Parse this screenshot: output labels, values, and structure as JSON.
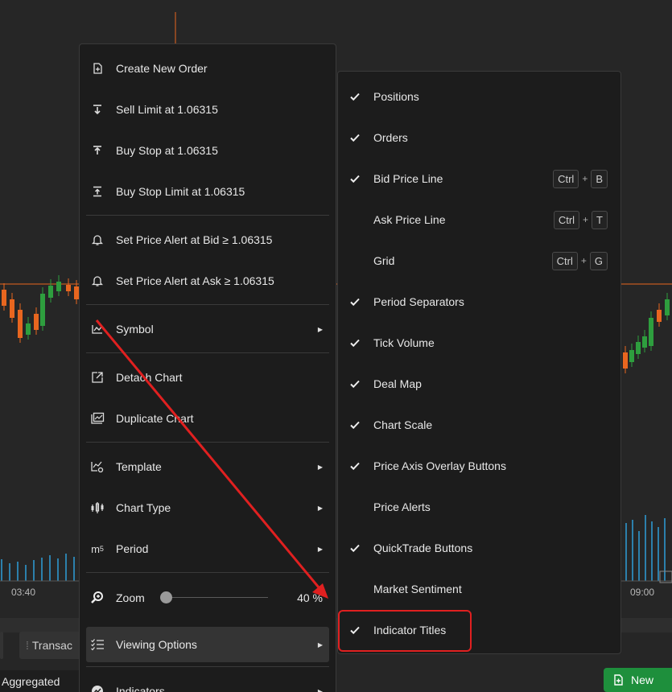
{
  "chart": {
    "time_labels": [
      "03:40",
      "09:00"
    ],
    "colors": {
      "up": "#2e9e3e",
      "down": "#e8661f",
      "volume": "#2f9fd8",
      "price_line": "#e8661f"
    }
  },
  "bottom": {
    "tab_partial": "Transac",
    "aggregated": "Aggregated",
    "new_order": "New"
  },
  "main_menu": {
    "create_order": "Create New Order",
    "sell_limit": "Sell Limit at 1.06315",
    "buy_stop": "Buy Stop at 1.06315",
    "buy_stop_limit": "Buy Stop Limit at 1.06315",
    "alert_bid": "Set Price Alert at Bid ≥ 1.06315",
    "alert_ask": "Set Price Alert at Ask ≥ 1.06315",
    "symbol": "Symbol",
    "detach": "Detach Chart",
    "duplicate": "Duplicate Chart",
    "template": "Template",
    "chart_type": "Chart Type",
    "period": "Period",
    "zoom": "Zoom",
    "zoom_value": "40 %",
    "viewing_options": "Viewing Options",
    "indicators": "Indicators"
  },
  "viewing_options": [
    {
      "label": "Positions",
      "checked": true
    },
    {
      "label": "Orders",
      "checked": true
    },
    {
      "label": "Bid Price Line",
      "checked": true,
      "shortcut": [
        "Ctrl",
        "+",
        "B"
      ]
    },
    {
      "label": "Ask Price Line",
      "checked": false,
      "shortcut": [
        "Ctrl",
        "+",
        "T"
      ]
    },
    {
      "label": "Grid",
      "checked": false,
      "shortcut": [
        "Ctrl",
        "+",
        "G"
      ]
    },
    {
      "label": "Period Separators",
      "checked": true
    },
    {
      "label": "Tick Volume",
      "checked": true
    },
    {
      "label": "Deal Map",
      "checked": true
    },
    {
      "label": "Chart Scale",
      "checked": true
    },
    {
      "label": "Price Axis Overlay Buttons",
      "checked": true
    },
    {
      "label": "Price Alerts",
      "checked": false
    },
    {
      "label": "QuickTrade Buttons",
      "checked": true
    },
    {
      "label": "Market Sentiment",
      "checked": false
    },
    {
      "label": "Indicator Titles",
      "checked": true
    }
  ],
  "annotation": {
    "color": "#e02020"
  }
}
